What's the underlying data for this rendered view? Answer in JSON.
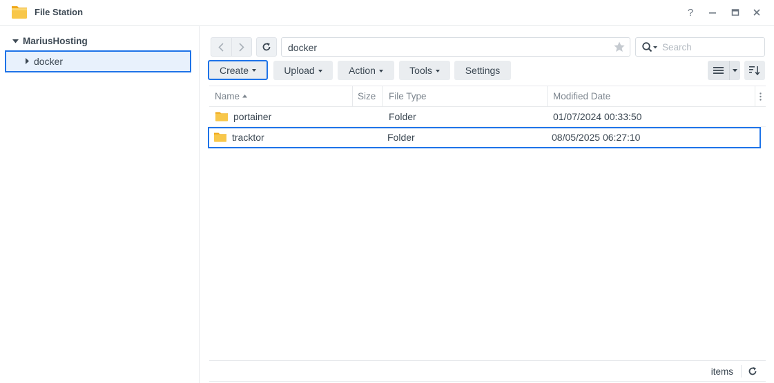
{
  "window": {
    "title": "File Station",
    "help_label": "?"
  },
  "sidebar": {
    "root_label": "MariusHosting",
    "items": [
      {
        "label": "docker"
      }
    ]
  },
  "toolbar": {
    "path_value": "docker",
    "search_placeholder": "Search",
    "create_label": "Create",
    "upload_label": "Upload",
    "action_label": "Action",
    "tools_label": "Tools",
    "settings_label": "Settings"
  },
  "table": {
    "columns": {
      "name": "Name",
      "size": "Size",
      "file_type": "File Type",
      "modified": "Modified Date"
    },
    "rows": [
      {
        "name": "portainer",
        "size": "",
        "type": "Folder",
        "modified": "01/07/2024 00:33:50"
      },
      {
        "name": "tracktor",
        "size": "",
        "type": "Folder",
        "modified": "08/05/2025 06:27:10"
      }
    ]
  },
  "footer": {
    "items_label": "items"
  },
  "colors": {
    "accent": "#1e73e8",
    "folder": "#f8c74a",
    "selection_bg": "#e8f1fc"
  }
}
